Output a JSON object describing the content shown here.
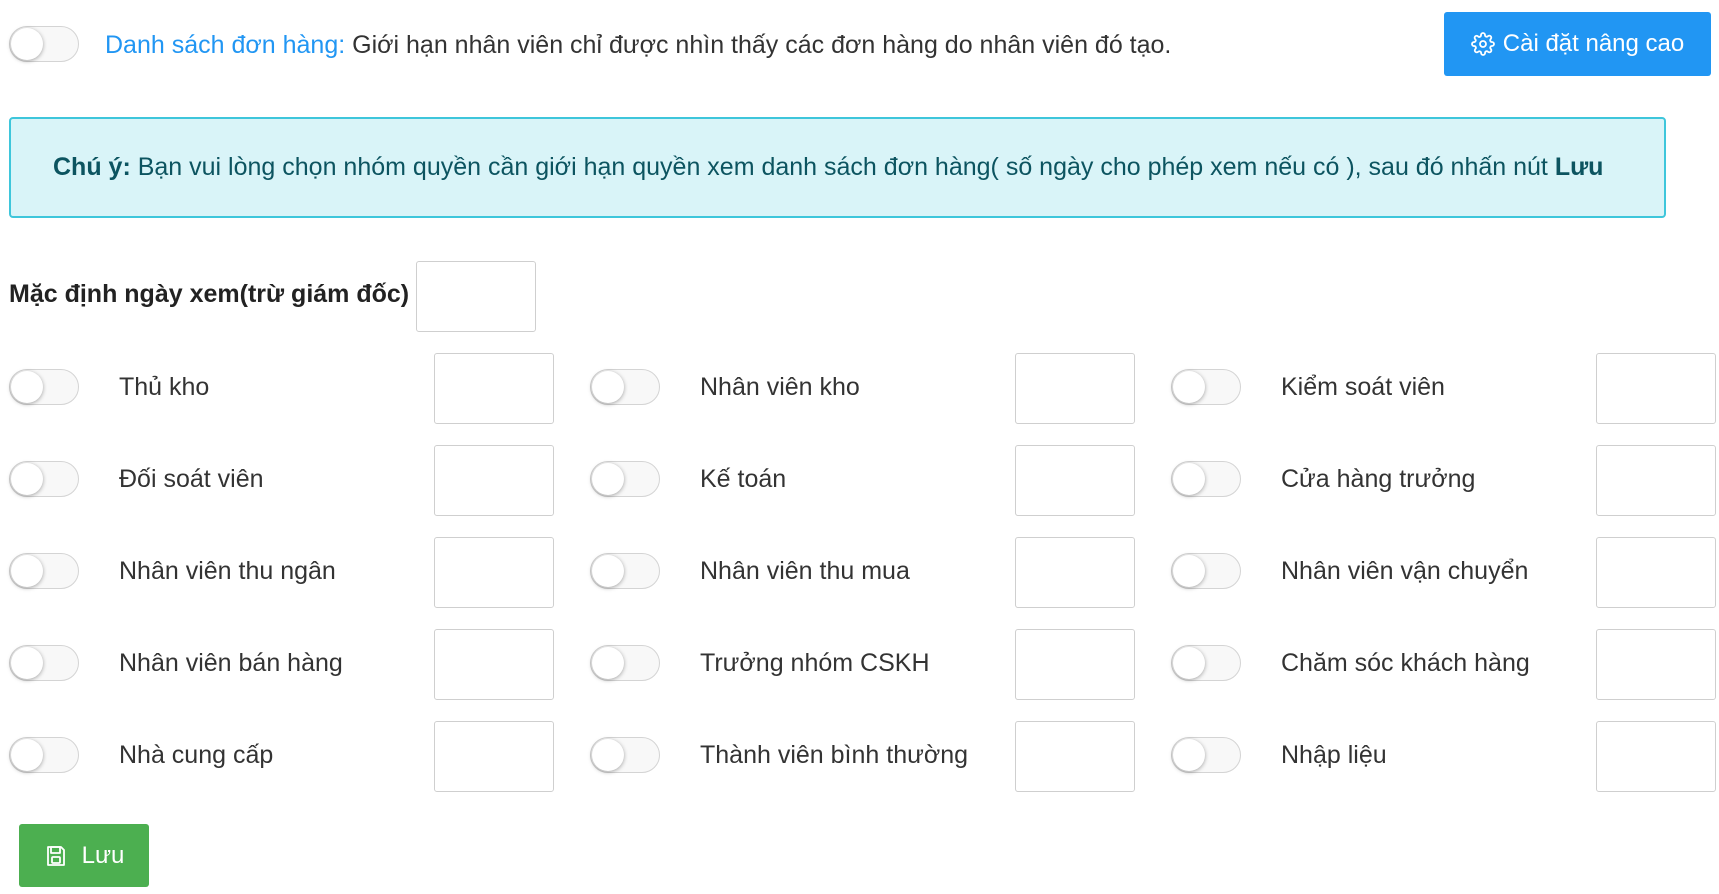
{
  "top": {
    "toggle_on": false,
    "lead_label": "Danh sách đơn hàng:",
    "description": " Giới hạn nhân viên chỉ được nhìn thấy các đơn hàng do nhân viên đó tạo.",
    "advanced_button_label": "Cài đặt nâng cao",
    "advanced_button_icon": "gear-icon"
  },
  "notice": {
    "prefix": "Chú ý:",
    "message": " Bạn vui lòng chọn nhóm quyền cần giới hạn quyền xem danh sách đơn hàng( số ngày cho phép xem nếu có ), sau đó nhấn nút ",
    "emphasis": "Lưu"
  },
  "default_days": {
    "label": "Mặc định ngày xem(trừ giám đốc)",
    "value": ""
  },
  "roles": [
    {
      "label": "Thủ kho",
      "enabled": false,
      "days": ""
    },
    {
      "label": "Nhân viên kho",
      "enabled": false,
      "days": ""
    },
    {
      "label": "Kiểm soát viên",
      "enabled": false,
      "days": ""
    },
    {
      "label": "Đối soát viên",
      "enabled": false,
      "days": ""
    },
    {
      "label": "Kế toán",
      "enabled": false,
      "days": ""
    },
    {
      "label": "Cửa hàng trưởng",
      "enabled": false,
      "days": ""
    },
    {
      "label": "Nhân viên thu ngân",
      "enabled": false,
      "days": ""
    },
    {
      "label": "Nhân viên thu mua",
      "enabled": false,
      "days": ""
    },
    {
      "label": "Nhân viên vận chuyển",
      "enabled": false,
      "days": ""
    },
    {
      "label": "Nhân viên bán hàng",
      "enabled": false,
      "days": ""
    },
    {
      "label": "Trưởng nhóm CSKH",
      "enabled": false,
      "days": ""
    },
    {
      "label": "Chăm sóc khách hàng",
      "enabled": false,
      "days": ""
    },
    {
      "label": "Nhà cung cấp",
      "enabled": false,
      "days": ""
    },
    {
      "label": "Thành viên bình thường",
      "enabled": false,
      "days": ""
    },
    {
      "label": "Nhập liệu",
      "enabled": false,
      "days": ""
    }
  ],
  "save_button": {
    "label": "Lưu",
    "icon": "floppy-disk-icon"
  },
  "colors": {
    "primary": "#2196f3",
    "success": "#4caf50",
    "notice_bg": "#d9f4f8",
    "notice_border": "#3ec6db",
    "notice_text": "#0c5460"
  }
}
